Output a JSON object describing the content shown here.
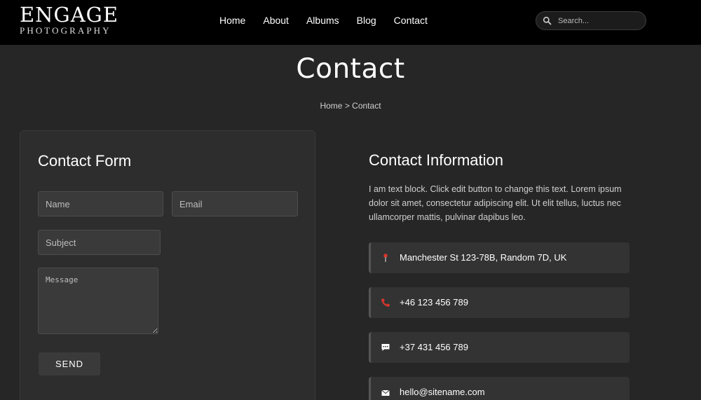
{
  "brand": {
    "name": "ENGAGE",
    "tagline": "PHOTOGRAPHY"
  },
  "nav": [
    {
      "label": "Home"
    },
    {
      "label": "About"
    },
    {
      "label": "Albums"
    },
    {
      "label": "Blog"
    },
    {
      "label": "Contact"
    }
  ],
  "search": {
    "placeholder": "Search..."
  },
  "page": {
    "title": "Contact",
    "breadcrumb": {
      "home": "Home",
      "separator": " > ",
      "current": "Contact"
    }
  },
  "form": {
    "title": "Contact Form",
    "name_placeholder": "Name",
    "email_placeholder": "Email",
    "subject_placeholder": "Subject",
    "message_placeholder": "Message",
    "send_label": "SEND"
  },
  "info": {
    "title": "Contact Information",
    "text": "I am text block. Click edit button to change this text. Lorem ipsum dolor sit amet, consectetur adipiscing elit. Ut elit tellus, luctus nec ullamcorper mattis, pulvinar dapibus leo.",
    "items": [
      {
        "icon": "map-pin-icon",
        "text": "Manchester St 123-78B, Random 7D, UK"
      },
      {
        "icon": "phone-icon",
        "text": "+46 123 456 789"
      },
      {
        "icon": "chat-icon",
        "text": "+37 431 456 789"
      },
      {
        "icon": "envelope-icon",
        "text": "hello@sitename.com"
      }
    ]
  },
  "colors": {
    "accent": "#d9362b",
    "background": "#262626",
    "header": "#000000"
  }
}
